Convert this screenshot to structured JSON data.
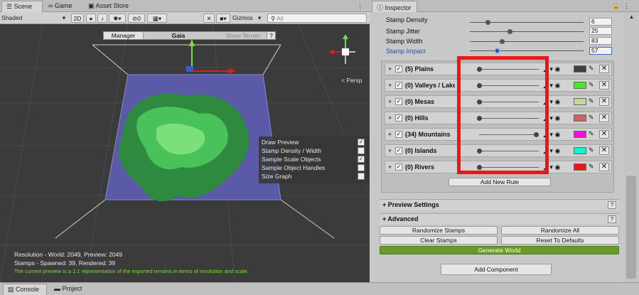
{
  "scene_tabs": [
    {
      "label": "Scene",
      "icon": "hash-icon"
    },
    {
      "label": "Game",
      "icon": "gamepad-icon"
    },
    {
      "label": "Asset Store",
      "icon": "store-icon"
    }
  ],
  "scene_toolbar": {
    "shading_mode": "Shaded",
    "mode_2d": "2D",
    "effects_count": "0",
    "gizmos_label": "Gizmos",
    "search_placeholder": "All"
  },
  "gaia_bar": {
    "manager_label": "Manager",
    "title": "Gaia",
    "show_terrain_label": "Show Terrain",
    "help": "?"
  },
  "persp_label": "< Persp",
  "preview_overlay": [
    {
      "label": "Draw Preview",
      "checked": true
    },
    {
      "label": "Stamp Density / Width",
      "checked": false
    },
    {
      "label": "Sample Scale Objects",
      "checked": true
    },
    {
      "label": "Sample Object Handles",
      "checked": false
    },
    {
      "label": "Size Graph",
      "checked": false
    }
  ],
  "stats": {
    "resolution": "Resolution - World: 2049, Preview: 2049",
    "stamps": "Stamps - Spawned: 39, Rendered: 39",
    "note": "The current preview is a 1:1 representation of the exported terrains in terms of resolution and scale."
  },
  "inspector_tab": "Inspector",
  "stamp_props": [
    {
      "label": "Stamp Density",
      "value": "6",
      "knob": 0.1
    },
    {
      "label": "Stamp Jitter",
      "value": "25",
      "knob": 0.28
    },
    {
      "label": "Stamp Width",
      "value": "83",
      "knob": 0.18
    },
    {
      "label": "Stamp Impact",
      "value": "57",
      "knob": 0.12,
      "highlighted": true
    }
  ],
  "rules": [
    {
      "name": "(5) Plains",
      "level": 0.0,
      "color": "#404040"
    },
    {
      "name": "(0) Valleys / Lake",
      "level": 0.0,
      "color": "#3cf01e"
    },
    {
      "name": "(0) Mesas",
      "level": 0.0,
      "color": "#c2d8a0"
    },
    {
      "name": "(0) Hills",
      "level": 0.0,
      "color": "#c86464"
    },
    {
      "name": "(34) Mountains",
      "level": 0.95,
      "color": "#f014d2"
    },
    {
      "name": "(0) Islands",
      "level": 0.0,
      "color": "#14f0d2"
    },
    {
      "name": "(0) Rivers",
      "level": 0.0,
      "color": "#f01414"
    }
  ],
  "add_rule_label": "Add New Rule",
  "preview_settings_label": "+ Preview Settings",
  "advanced_label": "+ Advanced",
  "help_glyph": "?",
  "buttons": {
    "randomize_stamps": "Randomize Stamps",
    "randomize_all": "Randomize All",
    "clear_stamps": "Clear Stamps",
    "reset_defaults": "Reset To Defaults",
    "generate_world": "Generate World",
    "add_component": "Add Component"
  },
  "bottom_tabs": [
    {
      "label": "Console",
      "icon": "console-icon"
    },
    {
      "label": "Project",
      "icon": "folder-icon"
    }
  ],
  "colors": {
    "highlight": "#f01414",
    "generate": "#6a9a2a",
    "stamp_impact_label": "#2a4fa0"
  }
}
